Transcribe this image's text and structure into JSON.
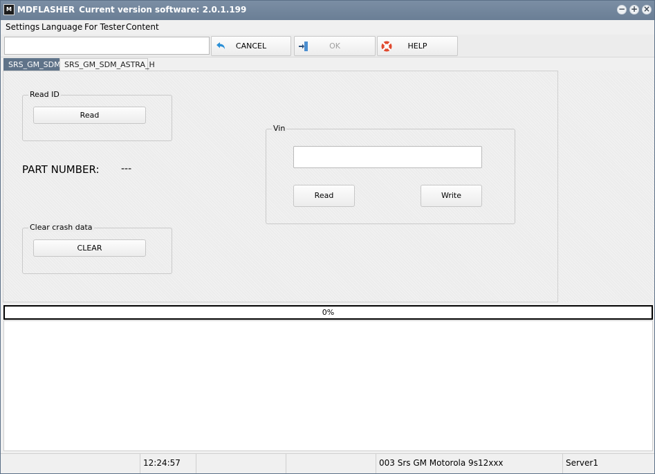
{
  "window": {
    "app_name": "MDFLASHER",
    "version_text": "Current version software: 2.0.1.199",
    "icon_text": "M"
  },
  "menu": {
    "items": [
      "Settings",
      "Language",
      "For Tester",
      "Content"
    ]
  },
  "toolbar": {
    "input_value": "",
    "cancel_label": "CANCEL",
    "ok_label": "OK",
    "help_label": "HELP"
  },
  "tabs": [
    {
      "label": "SRS_GM_SDM",
      "active": true
    },
    {
      "label": "SRS_GM_SDM_ASTRA_H",
      "active": false
    }
  ],
  "read_id": {
    "title": "Read ID",
    "button_label": "Read"
  },
  "part_number": {
    "label": "PART NUMBER:",
    "value": "---"
  },
  "clear_crash": {
    "title": "Clear crash data",
    "button_label": "CLEAR"
  },
  "vin": {
    "title": "Vin",
    "input_value": "",
    "read_label": "Read",
    "write_label": "Write"
  },
  "progress": {
    "value": 0,
    "text": "0%"
  },
  "status": {
    "time": "12:24:57",
    "module": "003 Srs GM Motorola 9s12xxx",
    "server": "Server1"
  },
  "colors": {
    "titlebar": "#6f839a",
    "active_tab": "#5f7389",
    "cancel_icon": "#2a8fd6",
    "help_icon": "#e04a2f"
  }
}
